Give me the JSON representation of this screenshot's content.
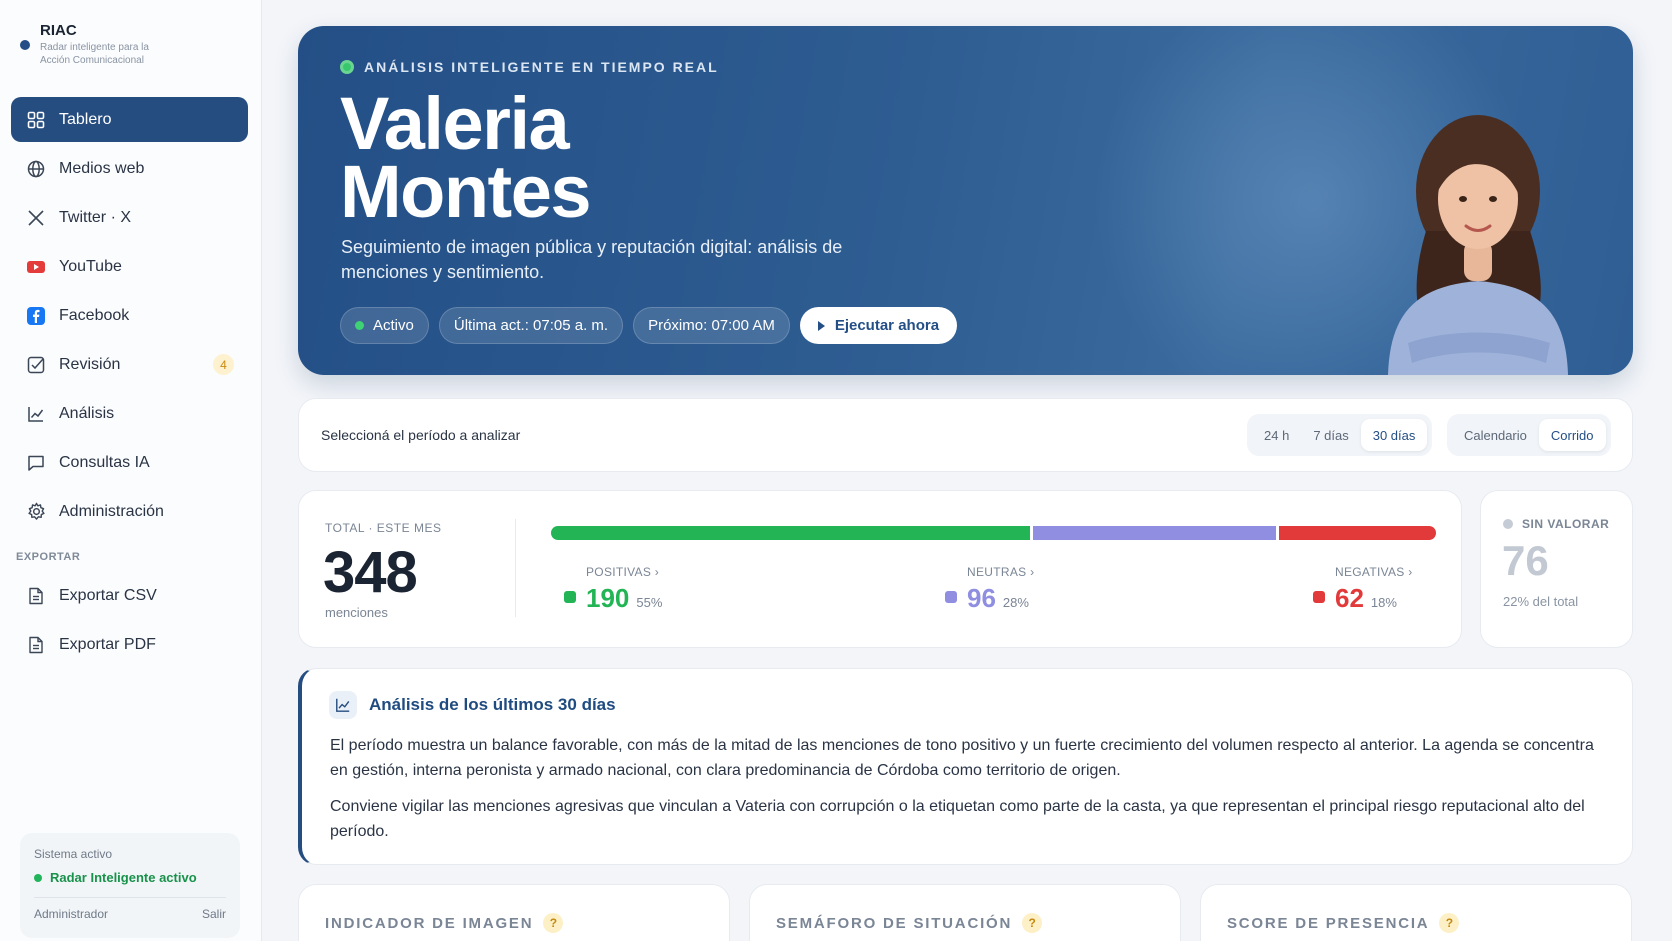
{
  "brand": {
    "name": "RIAC",
    "tagline": "Radar inteligente para la Acción Comunicacional"
  },
  "nav": [
    {
      "label": "Tablero",
      "icon": "grid-icon",
      "active": true
    },
    {
      "label": "Medios web",
      "icon": "globe-icon"
    },
    {
      "label": "Twitter · X",
      "icon": "x-logo-icon"
    },
    {
      "label": "YouTube",
      "icon": "youtube-icon"
    },
    {
      "label": "Facebook",
      "icon": "facebook-icon"
    },
    {
      "label": "Revisión",
      "icon": "check-square-icon",
      "badge": "4"
    },
    {
      "label": "Análisis",
      "icon": "line-chart-icon"
    },
    {
      "label": "Consultas IA",
      "icon": "chat-icon"
    },
    {
      "label": "Administración",
      "icon": "gear-icon"
    }
  ],
  "export": {
    "section_label": "EXPORTAR",
    "items": [
      {
        "label": "Exportar CSV",
        "icon": "file-icon"
      },
      {
        "label": "Exportar PDF",
        "icon": "file-icon"
      }
    ]
  },
  "system": {
    "title": "Sistema activo",
    "status": "Radar Inteligente activo",
    "user": "Administrador",
    "logout": "Salir"
  },
  "hero": {
    "kicker": "ANÁLISIS INTELIGENTE EN TIEMPO REAL",
    "name_line1": "Valeria",
    "name_line2": "Montes",
    "subtitle": "Seguimiento de imagen pública y reputación digital: análisis de menciones y sentimiento.",
    "status": "Activo",
    "last_update": "Última act.: 07:05 a. m.",
    "next_run": "Próximo: 07:00 AM",
    "run_button": "Ejecutar ahora"
  },
  "period": {
    "label": "Seleccioná el período a analizar",
    "ranges": [
      "24 h",
      "7 días",
      "30 días"
    ],
    "selected_range": "30 días",
    "modes": [
      "Calendario",
      "Corrido"
    ],
    "selected_mode": "Corrido"
  },
  "stats": {
    "total_label": "TOTAL · ESTE MES",
    "total": "348",
    "total_unit": "menciones",
    "positive": {
      "label": "POSITIVAS ›",
      "value": "190",
      "pct": "55%",
      "color": "#22b455",
      "share": 0.55
    },
    "neutral": {
      "label": "NEUTRAS ›",
      "value": "96",
      "pct": "28%",
      "color": "#8f8ee0",
      "share": 0.28
    },
    "negative": {
      "label": "NEGATIVAS ›",
      "value": "62",
      "pct": "18%",
      "color": "#e23a3a",
      "share": 0.18
    },
    "unrated": {
      "label": "SIN VALORAR",
      "value": "76",
      "pct": "22% del total"
    }
  },
  "analysis": {
    "title": "Análisis de los últimos 30 días",
    "p1": "El período muestra un balance favorable, con más de la mitad de las menciones de tono positivo y un fuerte crecimiento del volumen respecto al anterior. La agenda se concentra en gestión, interna peronista y armado nacional, con clara predominancia de Córdoba como territorio de origen.",
    "p2": "Conviene vigilar las menciones agresivas que vinculan a Vateria con corrupción o la etiquetan como parte de la casta, ya que representan el principal riesgo reputacional alto del período."
  },
  "cards": [
    {
      "title": "INDICADOR DE IMAGEN",
      "help": "?"
    },
    {
      "title": "SEMÁFORO DE SITUACIÓN",
      "help": "?"
    },
    {
      "title": "SCORE DE PRESENCIA",
      "help": "?"
    }
  ]
}
